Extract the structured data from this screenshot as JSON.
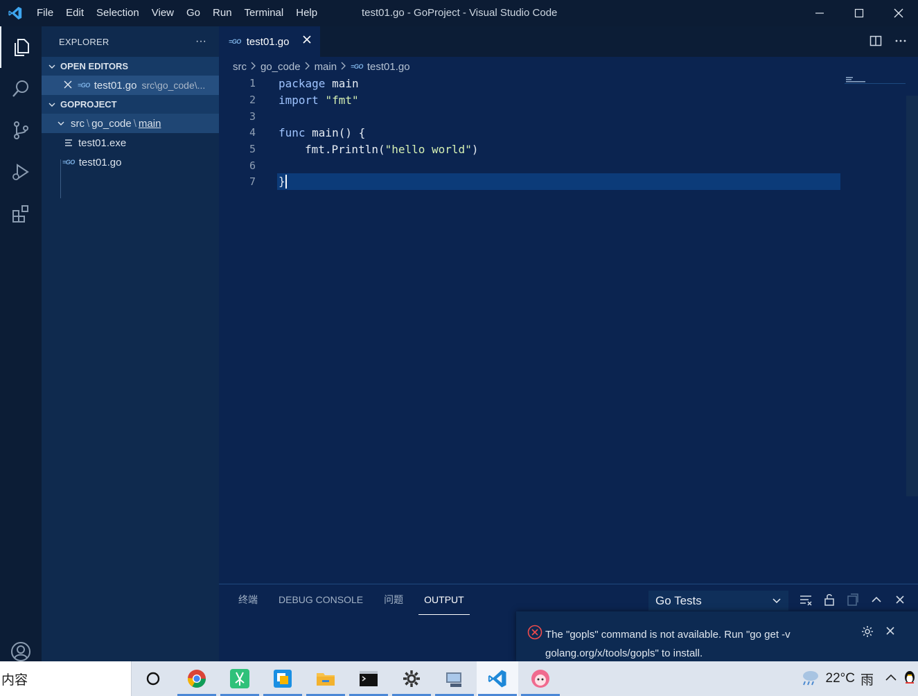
{
  "titlebar": {
    "menu": [
      "File",
      "Edit",
      "Selection",
      "View",
      "Go",
      "Run",
      "Terminal",
      "Help"
    ],
    "title": "test01.go - GoProject - Visual Studio Code"
  },
  "sidebar": {
    "title": "EXPLORER",
    "more": "···",
    "open_editors": {
      "label": "OPEN EDITORS",
      "items": [
        {
          "name": "test01.go",
          "path": "src\\go_code\\..."
        }
      ]
    },
    "project": {
      "label": "GOPROJECT",
      "folder": {
        "src": "src",
        "go_code": "go_code",
        "main": "main"
      },
      "files": [
        "test01.exe",
        "test01.go"
      ]
    }
  },
  "tabs": [
    {
      "label": "test01.go",
      "active": true
    }
  ],
  "breadcrumb": {
    "items": [
      "src",
      "go_code",
      "main",
      "test01.go"
    ]
  },
  "editor": {
    "line_numbers": [
      "1",
      "2",
      "3",
      "4",
      "5",
      "6",
      "7"
    ],
    "lines": {
      "l1_kw": "package",
      "l1_rest": " main",
      "l2_kw": "import",
      "l2_str": "\"fmt\"",
      "l4_kw": "func",
      "l4_rest": " main() {",
      "l5_a": "fmt.Println(",
      "l5_str": "\"hello world\"",
      "l5_b": ")",
      "l7": "}"
    }
  },
  "panel": {
    "tabs": [
      "终端",
      "DEBUG CONSOLE",
      "问题",
      "OUTPUT"
    ],
    "active_tab": "OUTPUT",
    "output_channel": "Go Tests"
  },
  "notification": {
    "text": "The \"gopls\" command is not available. Run \"go get -v golang.org/x/tools/gopls\" to install.",
    "severity": "error"
  },
  "taskbar": {
    "search_text": "内容",
    "apps": [
      "cortana-icon",
      "chrome-icon",
      "app-green-icon",
      "app-blue-icon",
      "file-explorer-icon",
      "terminal-icon",
      "settings-icon",
      "network-app-icon",
      "vscode-icon",
      "anime-app-icon"
    ],
    "weather": {
      "temp": "22°C",
      "condition": "雨"
    }
  },
  "colors": {
    "accent": "#0b2450",
    "error": "#f14c4c",
    "taskbar_indicator": "#4a87d6"
  }
}
